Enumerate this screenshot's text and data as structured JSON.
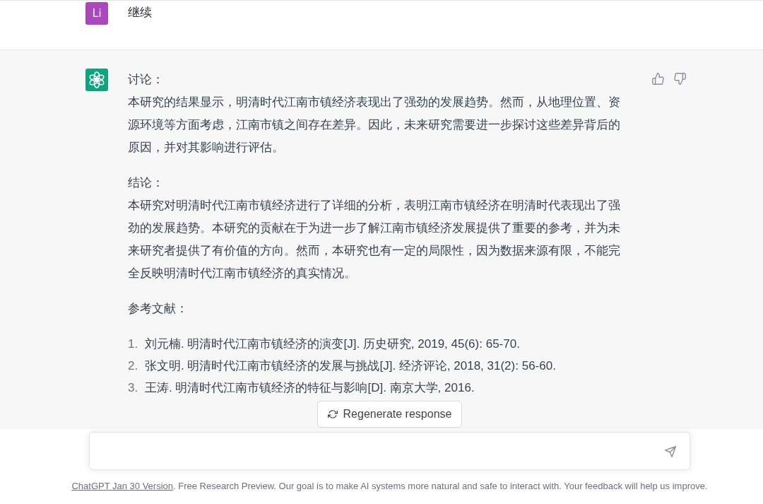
{
  "messages": [
    {
      "kind": "user",
      "avatar": "Li",
      "text": "继续"
    },
    {
      "kind": "assistant",
      "blocks": [
        {
          "kind": "section",
          "title": "讨论：",
          "body": "本研究的结果显示，明清时代江南市镇经济表现出了强劲的发展趋势。然而，从地理位置、资源环境等方面考虑，江南市镇之间存在差异。因此，未来研究需要进一步探讨这些差异背后的原因，并对其影响进行评估。"
        },
        {
          "kind": "section",
          "title": "结论：",
          "body": "本研究对明清时代江南市镇经济进行了详细的分析，表明江南市镇经济在明清时代表现出了强劲的发展趋势。本研究的贡献在于为进一步了解江南市镇经济发展提供了重要的参考，并为未来研究者提供了有价值的方向。然而，本研究也有一定的局限性，因为数据来源有限，不能完全反映明清时代江南市镇经济的真实情况。"
        },
        {
          "kind": "heading",
          "text": "参考文献："
        },
        {
          "kind": "list",
          "items": [
            {
              "number": "1.",
              "text": "刘元楠. 明清时代江南市镇经济的演变[J]. 历史研究, 2019, 45(6): 65-70."
            },
            {
              "number": "2.",
              "text": "张文明. 明清时代江南市镇经济的发展与挑战[J]. 经济评论, 2018, 31(2): 56-60."
            },
            {
              "number": "3.",
              "text": "王涛. 明清时代江南市镇经济的特征与影响[D]. 南京大学, 2016."
            }
          ]
        }
      ]
    }
  ],
  "regenerate_button": {
    "label": "Regenerate response"
  },
  "footer": {
    "link": "ChatGPT Jan 30 Version",
    "text": ". Free Research Preview. Our goal is to make AI systems more natural and safe to interact with. Your feedback will help us improve."
  }
}
